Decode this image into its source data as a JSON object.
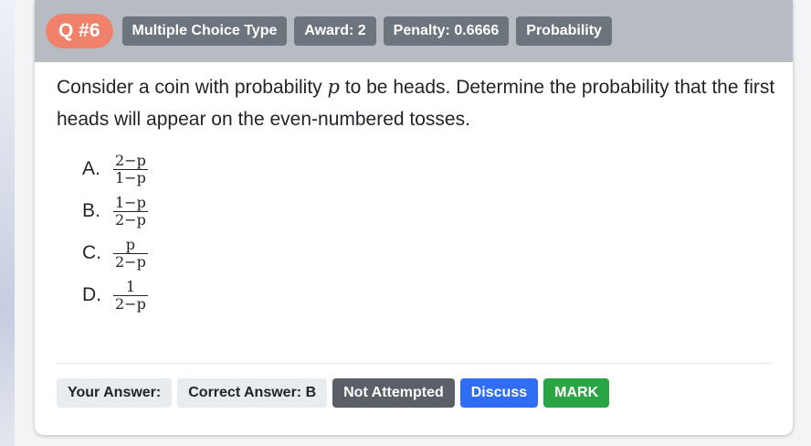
{
  "header": {
    "question_number": "Q #6",
    "tags": [
      "Multiple Choice Type",
      "Award: 2",
      "Penalty: 0.6666",
      "Probability"
    ]
  },
  "question": {
    "part1": "Consider a coin with probability ",
    "variable": "p",
    "part2": " to be heads. Determine the probability that the first heads will appear on the even-numbered tosses."
  },
  "options": [
    {
      "label": "A.",
      "numerator": "2−p",
      "denominator": "1−p"
    },
    {
      "label": "B.",
      "numerator": "1−p",
      "denominator": "2−p"
    },
    {
      "label": "C.",
      "numerator": "p",
      "denominator": "2−p"
    },
    {
      "label": "D.",
      "numerator": "1",
      "denominator": "2−p"
    }
  ],
  "footer": {
    "your_answer": "Your Answer:",
    "correct_answer": "Correct Answer: B",
    "status": "Not Attempted",
    "discuss": "Discuss",
    "mark": "MARK"
  },
  "colors": {
    "header_bg": "#b7bcc3",
    "qnum_bg": "#f0826c",
    "tag_bg": "#6c757d",
    "discuss_bg": "#2f6df3",
    "mark_bg": "#2aa544",
    "status_bg": "#5b6068"
  }
}
